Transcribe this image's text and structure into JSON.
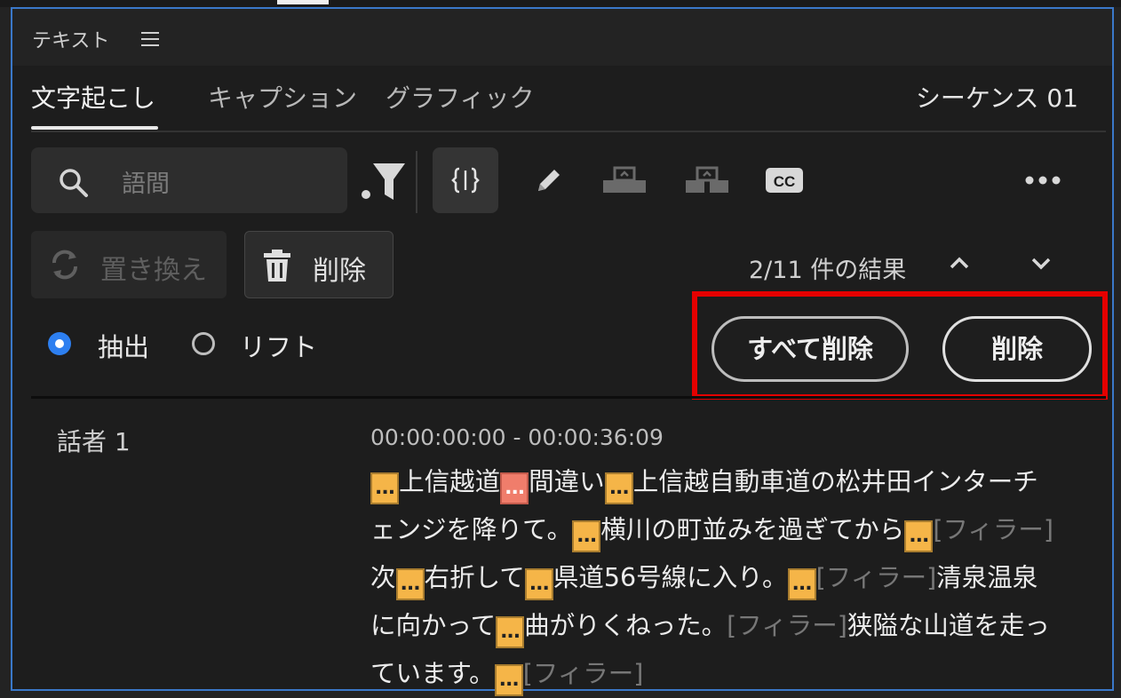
{
  "panel": {
    "title": "テキスト",
    "tabs": [
      {
        "label": "文字起こし",
        "active": true
      },
      {
        "label": "キャプション",
        "active": false
      },
      {
        "label": "グラフィック",
        "active": false
      }
    ],
    "sequence_name": "シーケンス 01"
  },
  "toolbar": {
    "search_placeholder": "語間",
    "icons": [
      "search-icon",
      "filter-icon",
      "pause-gaps-icon",
      "pencil-icon",
      "merge-segments-icon",
      "split-segments-icon",
      "cc-icon",
      "more-icon"
    ],
    "cc_label": "CC"
  },
  "actions": {
    "replace_label": "置き換え",
    "delete_label": "削除",
    "results_text": "2/11 件の結果"
  },
  "options": {
    "extract_label": "抽出",
    "lift_label": "リフト",
    "selected": "抽出"
  },
  "confirm": {
    "delete_all_label": "すべて削除",
    "delete_label": "削除"
  },
  "transcript": {
    "speaker": "話者 1",
    "timecode": "00:00:00:00 - 00:00:36:09",
    "pause_marker": "...",
    "segments": {
      "s1": "上信越道",
      "s2": "間違い",
      "s3": "上信越自動車道の松井田インターチェンジを降りて。",
      "s4": "横川の町並みを過ぎてから",
      "f1": "[フィラー]",
      "s5": "次",
      "s6": "右折して",
      "s7": "県道56号線に入り。",
      "f2": "[フィラー]",
      "s8": "清泉温泉に向かって",
      "s9": "曲がりくねった。",
      "f3": "[フィラー]",
      "s10": "狭隘な山道を走っています。",
      "f4": "[フィラー]"
    }
  },
  "colors": {
    "accent_blue": "#2d7ff0",
    "pause_orange": "#f5b548",
    "pause_selected": "#f07d6b",
    "highlight_red": "#e50000"
  }
}
